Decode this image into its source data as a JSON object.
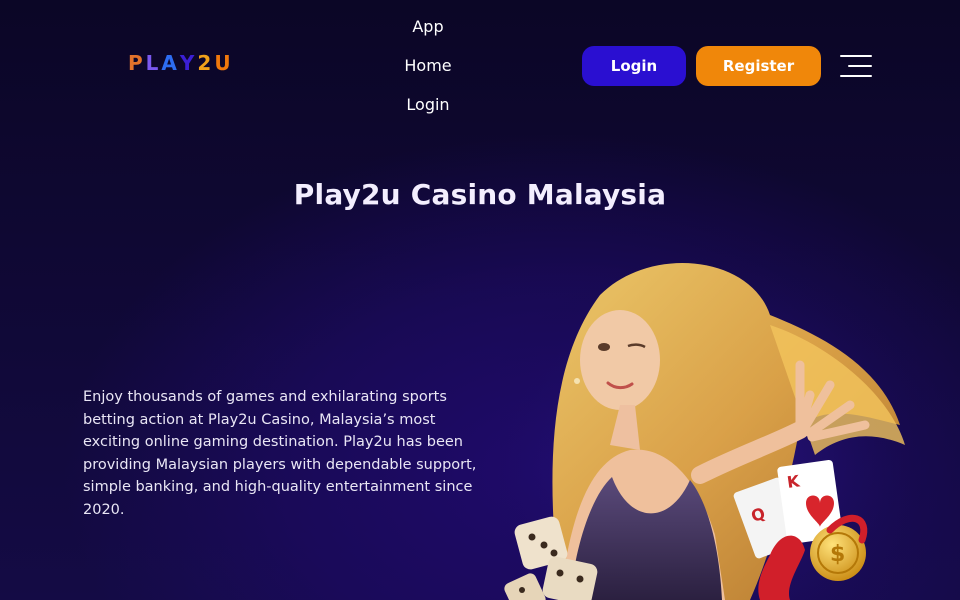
{
  "header": {
    "logo_letters": [
      {
        "char": "P",
        "color": "#e2722b"
      },
      {
        "char": "L",
        "color": "#7a58f0"
      },
      {
        "char": "A",
        "color": "#2d6cf2"
      },
      {
        "char": "Y",
        "color": "#3b1fd6"
      },
      {
        "char": "2",
        "color": "#f0a11a"
      },
      {
        "char": "U",
        "color": "#f0780c"
      }
    ],
    "nav": [
      "App",
      "Home",
      "Login"
    ],
    "login_label": "Login",
    "register_label": "Register",
    "menu_icon": "hamburger-menu-icon"
  },
  "hero": {
    "title": "Play2u Casino Malaysia",
    "text": "Enjoy thousands of games and exhilarating sports betting action at Play2u Casino, Malaysia’s most exciting online gaming destination. Play2u has been providing Malaysian players with dependable support, simple banking, and high-quality entertainment since 2020.",
    "image": "casino-woman-illustration",
    "image_card_letters": [
      "Q",
      "K"
    ]
  },
  "colors": {
    "login_button": "#2a0fd1",
    "register_button": "#f0870a",
    "background": "#0f0833"
  }
}
